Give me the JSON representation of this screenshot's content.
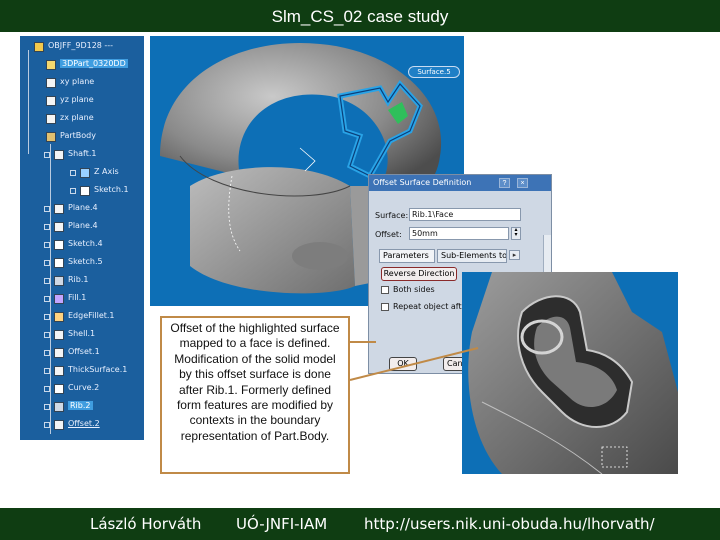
{
  "slide": {
    "title": "Slm_CS_02 case study"
  },
  "tree": {
    "items": [
      {
        "label": "OBJFF_9D128 ---",
        "icon": "part-document-icon",
        "indent": 0
      },
      {
        "label": "3DPart_0320DD",
        "icon": "part-icon",
        "indent": 1,
        "selected": true
      },
      {
        "label": "xy plane",
        "icon": "plane-icon",
        "indent": 1
      },
      {
        "label": "yz plane",
        "icon": "plane-icon",
        "indent": 1
      },
      {
        "label": "zx plane",
        "icon": "plane-icon",
        "indent": 1
      },
      {
        "label": "PartBody",
        "icon": "body-icon",
        "indent": 1
      },
      {
        "label": "Shaft.1",
        "icon": "shaft-icon",
        "indent": 2
      },
      {
        "label": "Z Axis",
        "icon": "axis-icon",
        "indent": 3
      },
      {
        "label": "Sketch.1",
        "icon": "sketch-icon",
        "indent": 3
      },
      {
        "label": "Plane.4",
        "icon": "plane-icon",
        "indent": 2
      },
      {
        "label": "Plane.4",
        "icon": "plane-icon",
        "indent": 2
      },
      {
        "label": "Sketch.4",
        "icon": "sketch-icon",
        "indent": 2
      },
      {
        "label": "Sketch.5",
        "icon": "sketch-icon",
        "indent": 2
      },
      {
        "label": "Rib.1",
        "icon": "rib-icon",
        "indent": 2
      },
      {
        "label": "Fill.1",
        "icon": "fill-icon",
        "indent": 2
      },
      {
        "label": "EdgeFillet.1",
        "icon": "fillet-icon",
        "indent": 2
      },
      {
        "label": "Shell.1",
        "icon": "shell-icon",
        "indent": 2
      },
      {
        "label": "Offset.1",
        "icon": "offset-icon",
        "indent": 2
      },
      {
        "label": "ThickSurface.1",
        "icon": "thick-surface-icon",
        "indent": 2
      },
      {
        "label": "Curve.2",
        "icon": "curve-icon",
        "indent": 2
      },
      {
        "label": "Rib.2",
        "icon": "rib-icon",
        "indent": 2,
        "selected": true
      },
      {
        "label": "Offset.2",
        "icon": "offset-icon",
        "indent": 2,
        "underlined": true
      }
    ]
  },
  "viewport": {
    "tag_label": "Surface.5"
  },
  "dialog": {
    "title": "Offset Surface Definition",
    "surface_label": "Surface:",
    "surface_value": "Rib.1\\Face",
    "offset_label": "Offset:",
    "offset_value": "50mm",
    "tab_parameters": "Parameters",
    "tab_subelements": "Sub-Elements to r",
    "reverse_button": "Reverse Direction",
    "both_sides_label": "Both sides",
    "repeat_label": "Repeat object after",
    "ok_label": "OK",
    "cancel_label": "Canc"
  },
  "caption": {
    "text": "Offset of the highlighted surface mapped to a face is defined. Modification of the solid model by this offset surface is done after Rib.1. Formerly defined form features are modified by contexts in the boundary representation of Part.Body."
  },
  "footer": {
    "author": "László Horváth",
    "institute": "UÓ-JNFI-IAM",
    "url": "http://users.nik.uni-obuda.hu/lhorvath/"
  },
  "colors": {
    "slide_bar": "#0f3d12",
    "tree_background": "#1b5f9e",
    "viewport_background": "#0d6fb6",
    "highlight_cyan": "#29a3e6",
    "caption_border": "#c08a47"
  }
}
